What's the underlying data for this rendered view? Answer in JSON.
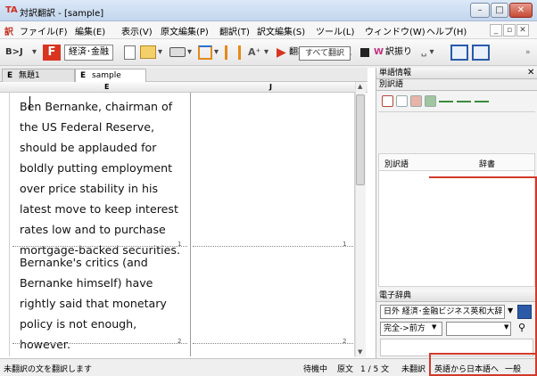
{
  "window": {
    "title": "対訳翻訳 - [sample]",
    "app_icon": "TA"
  },
  "menu": [
    "ファイル(F)",
    "編集(E)",
    "表示(V)",
    "原文編集(P)",
    "翻訳(T)",
    "訳文編集(S)",
    "ツール(L)",
    "ウィンドウ(W)",
    "ヘルプ(H)"
  ],
  "toolbar": {
    "mode_label": "B>J",
    "domain_label": "経済･金融",
    "translate_label": "翻訳",
    "translate_all_label": "翻訳",
    "translate_ruby_label": "訳振り",
    "tooltip": "すべて翻訳"
  },
  "tabs": [
    {
      "letter": "E",
      "label": "無題1"
    },
    {
      "letter": "E",
      "label": "sample"
    }
  ],
  "columns": {
    "source": "E",
    "target": "J"
  },
  "source_paragraphs": [
    "Ben Bernanke, chairman of the US Federal Reserve, should be applauded for boldly putting employment over price stability in his latest move to keep interest rates low and to purchase mortgage-backed securities.",
    "Bernanke's critics (and Bernanke himself) have rightly said that monetary policy is not enough, however."
  ],
  "paragraph_numbers": [
    "1",
    "2"
  ],
  "target_paragraph_numbers": [
    "1",
    "2"
  ],
  "right_panel": {
    "word_info_title": "単語情報",
    "alt_translation_title": "別訳語",
    "alt_table_headers": [
      "別訳語",
      "辞書"
    ],
    "dictionary_title": "電子辞典",
    "dictionary_select": "日外 経済･金融ビジネス英和大辞",
    "search_mode_select": "完全->前方"
  },
  "status": {
    "message": "未翻訳の文を翻訳します",
    "state": "待機中",
    "source_label": "原文",
    "sentence_pos": "1 / 5 文",
    "untranslated": "未翻訳",
    "direction": "英語から日本語へ",
    "field": "一般"
  },
  "colors": {
    "accent_red": "#d23a2a",
    "toolbar_bg": "#f0f0f0"
  }
}
